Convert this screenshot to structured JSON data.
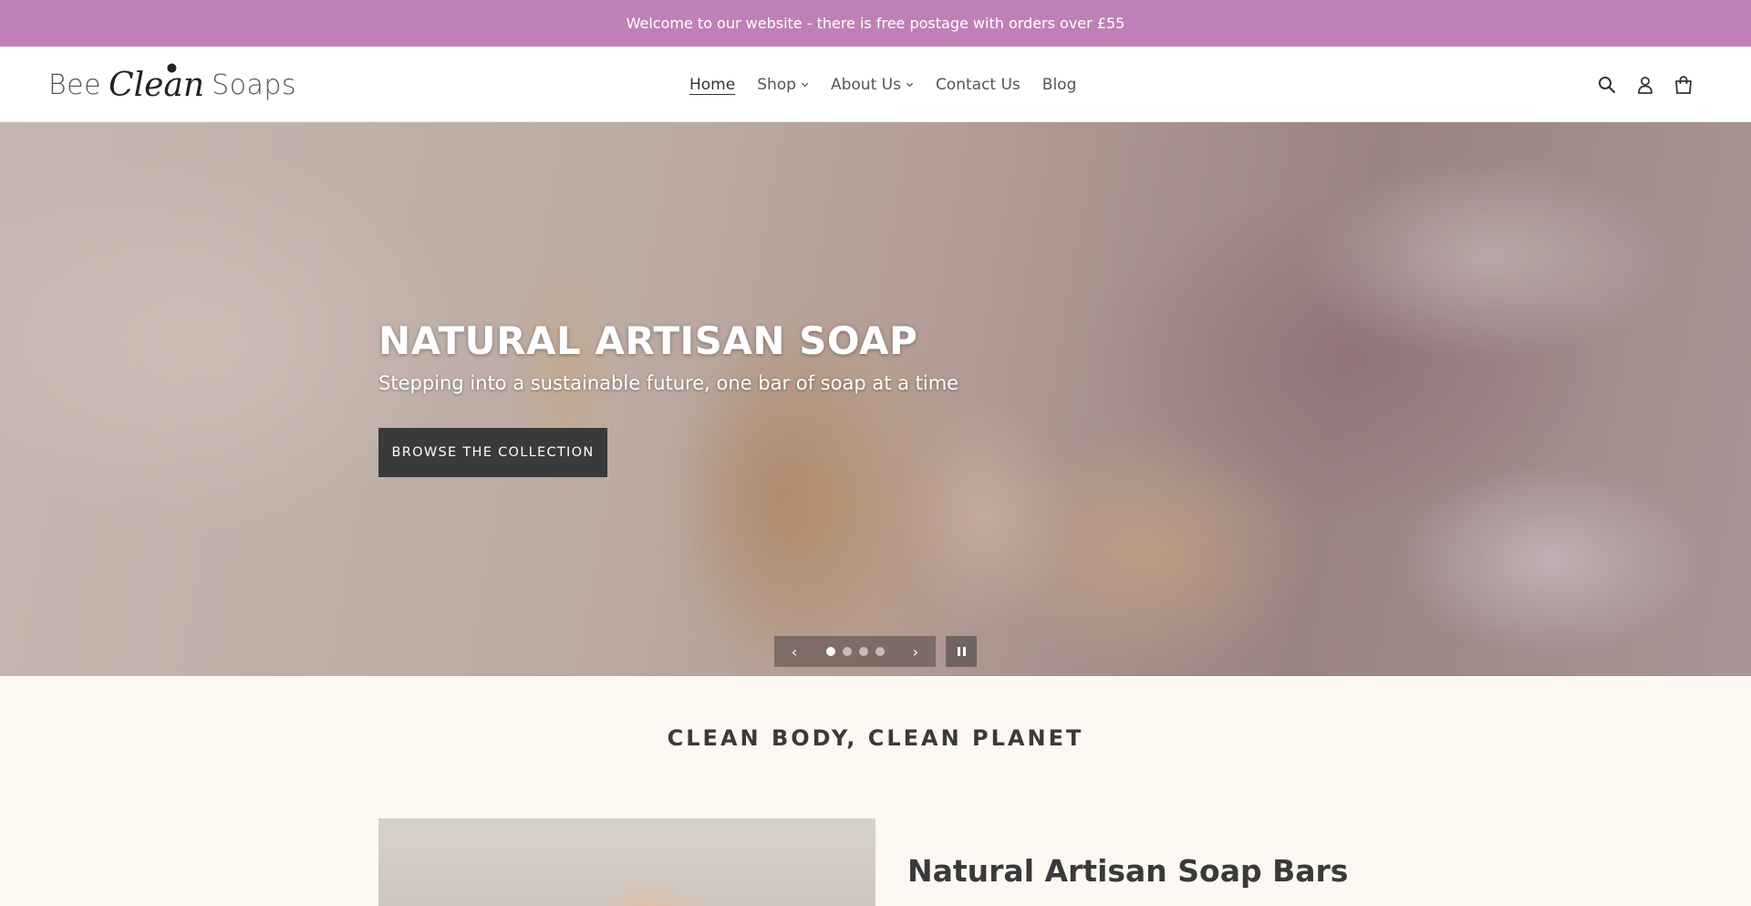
{
  "announcement": "Welcome to our website - there is free postage with orders over £55",
  "logo": {
    "word1": "Bee",
    "word2": "Clean",
    "word3": "Soaps"
  },
  "nav": {
    "home": "Home",
    "shop": "Shop",
    "about": "About Us",
    "contact": "Contact Us",
    "blog": "Blog"
  },
  "header_icons": [
    "search-icon",
    "account-icon",
    "cart-icon"
  ],
  "hero": {
    "title": "NATURAL ARTISAN SOAP",
    "subtitle": "Stepping into a sustainable future, one bar of soap at a time",
    "button": "BROWSE THE COLLECTION",
    "slides_count": 4,
    "active_slide": 1
  },
  "section_title": "CLEAN BODY, CLEAN PLANET",
  "feature": {
    "title": "Natural Artisan Soap Bars"
  },
  "colors": {
    "announcement_bg": "#bf80b8",
    "button_bg": "#3a3a3a",
    "page_bg": "#fdf8f2"
  }
}
